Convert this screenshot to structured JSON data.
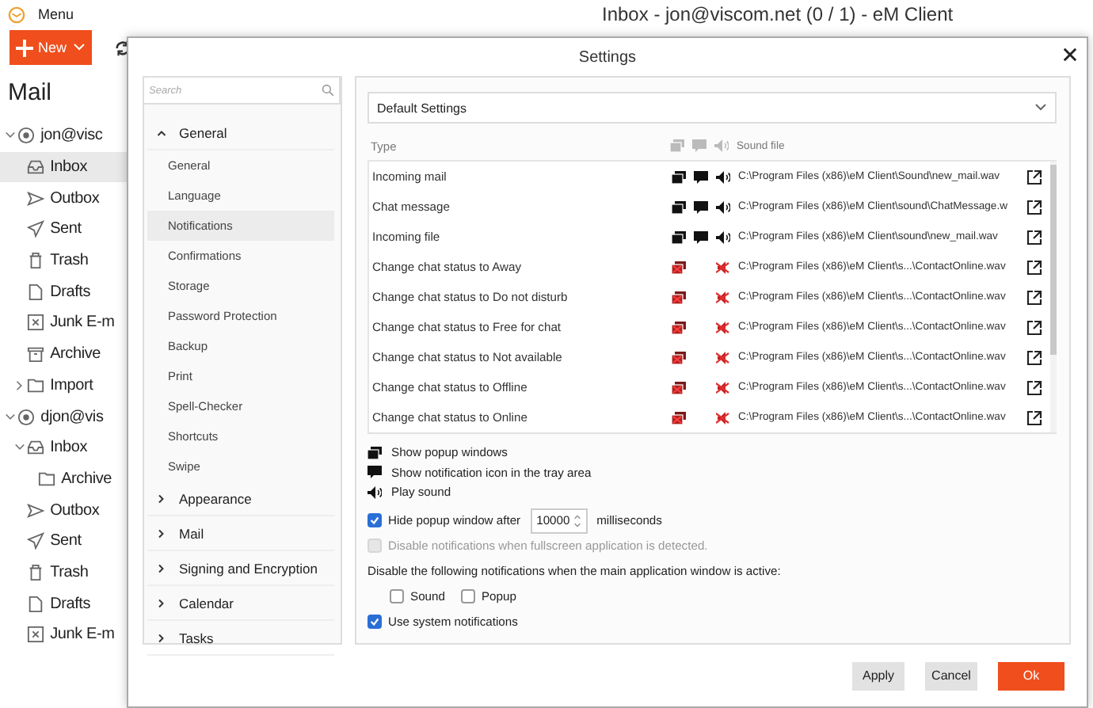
{
  "app": {
    "menu_label": "Menu",
    "title": "Inbox - jon@viscom.net (0 / 1) - eM Client",
    "new_button": "New",
    "mail_heading": "Mail",
    "accounts": [
      {
        "name": "jon@visc",
        "expanded": true,
        "folders": [
          {
            "kind": "inbox",
            "name": "Inbox",
            "selected": true
          },
          {
            "kind": "outbox",
            "name": "Outbox",
            "selected": false
          },
          {
            "kind": "sent",
            "name": "Sent",
            "selected": false
          },
          {
            "kind": "trash",
            "name": "Trash",
            "selected": false
          },
          {
            "kind": "drafts",
            "name": "Drafts",
            "selected": false
          },
          {
            "kind": "junk",
            "name": "Junk E-m",
            "selected": false
          },
          {
            "kind": "archive",
            "name": "Archive",
            "selected": false
          },
          {
            "kind": "folder",
            "name": "Import",
            "selected": false,
            "expanded": false
          }
        ]
      },
      {
        "name": "djon@vis",
        "expanded": true,
        "folders": [
          {
            "kind": "inbox",
            "name": "Inbox",
            "selected": false,
            "expanded": true,
            "children": [
              {
                "kind": "folder",
                "name": "Archive",
                "selected": false
              }
            ]
          },
          {
            "kind": "outbox",
            "name": "Outbox",
            "selected": false
          },
          {
            "kind": "sent",
            "name": "Sent",
            "selected": false
          },
          {
            "kind": "trash",
            "name": "Trash",
            "selected": false
          },
          {
            "kind": "drafts",
            "name": "Drafts",
            "selected": false
          },
          {
            "kind": "junk",
            "name": "Junk E-m",
            "selected": false
          }
        ]
      }
    ]
  },
  "settings": {
    "title": "Settings",
    "search": {
      "placeholder": "Search"
    },
    "nav": [
      {
        "label": "General",
        "expanded": true,
        "children": [
          {
            "label": "General",
            "selected": false
          },
          {
            "label": "Language",
            "selected": false
          },
          {
            "label": "Notifications",
            "selected": true
          },
          {
            "label": "Confirmations",
            "selected": false
          },
          {
            "label": "Storage",
            "selected": false
          },
          {
            "label": "Password Protection",
            "selected": false
          },
          {
            "label": "Backup",
            "selected": false
          },
          {
            "label": "Print",
            "selected": false
          },
          {
            "label": "Spell-Checker",
            "selected": false
          },
          {
            "label": "Shortcuts",
            "selected": false
          },
          {
            "label": "Swipe",
            "selected": false
          }
        ]
      },
      {
        "label": "Appearance",
        "expanded": false
      },
      {
        "label": "Mail",
        "expanded": false
      },
      {
        "label": "Signing and Encryption",
        "expanded": false
      },
      {
        "label": "Calendar",
        "expanded": false
      },
      {
        "label": "Tasks",
        "expanded": false
      }
    ],
    "profile": "Default Settings",
    "table": {
      "columns": [
        "Type",
        "Sound file"
      ],
      "rows": [
        {
          "type": "Incoming mail",
          "popup": true,
          "tray": true,
          "sound": true,
          "sound_file": "C:\\Program Files (x86)\\eM Client\\Sound\\new_mail.wav"
        },
        {
          "type": "Chat message",
          "popup": true,
          "tray": true,
          "sound": true,
          "sound_file": "C:\\Program Files (x86)\\eM Client\\sound\\ChatMessage.w"
        },
        {
          "type": "Incoming file",
          "popup": true,
          "tray": true,
          "sound": true,
          "sound_file": "C:\\Program Files (x86)\\eM Client\\sound\\new_mail.wav"
        },
        {
          "type": "Change chat status to Away",
          "popup": false,
          "tray": false,
          "sound": false,
          "sound_file": "C:\\Program Files (x86)\\eM Client\\s...\\ContactOnline.wav"
        },
        {
          "type": "Change chat status to Do not disturb",
          "popup": false,
          "tray": false,
          "sound": false,
          "sound_file": "C:\\Program Files (x86)\\eM Client\\s...\\ContactOnline.wav"
        },
        {
          "type": "Change chat status to Free for chat",
          "popup": false,
          "tray": false,
          "sound": false,
          "sound_file": "C:\\Program Files (x86)\\eM Client\\s...\\ContactOnline.wav"
        },
        {
          "type": "Change chat status to Not available",
          "popup": false,
          "tray": false,
          "sound": false,
          "sound_file": "C:\\Program Files (x86)\\eM Client\\s...\\ContactOnline.wav"
        },
        {
          "type": "Change chat status to Offline",
          "popup": false,
          "tray": false,
          "sound": false,
          "sound_file": "C:\\Program Files (x86)\\eM Client\\s...\\ContactOnline.wav"
        },
        {
          "type": "Change chat status to Online",
          "popup": false,
          "tray": false,
          "sound": false,
          "sound_file": "C:\\Program Files (x86)\\eM Client\\s...\\ContactOnline.wav"
        }
      ]
    },
    "legend": [
      {
        "kind": "popup",
        "label": "Show popup windows"
      },
      {
        "kind": "tray",
        "label": "Show notification icon in the tray area"
      },
      {
        "kind": "sound",
        "label": "Play sound"
      }
    ],
    "hide_popup": {
      "label": "Hide popup window after",
      "checked": true,
      "value": "10000",
      "unit": "milliseconds"
    },
    "fullscreen": {
      "label": "Disable notifications when fullscreen application is detected.",
      "checked": false,
      "disabled": true
    },
    "disable_when_active": {
      "label": "Disable the following notifications when the main application window is active:",
      "options": [
        {
          "label": "Sound",
          "checked": false
        },
        {
          "label": "Popup",
          "checked": false
        }
      ]
    },
    "system_notifications": {
      "label": "Use system notifications",
      "checked": true
    },
    "buttons": [
      {
        "label": "Apply",
        "primary": false
      },
      {
        "label": "Cancel",
        "primary": false
      },
      {
        "label": "Ok",
        "primary": true
      }
    ]
  }
}
